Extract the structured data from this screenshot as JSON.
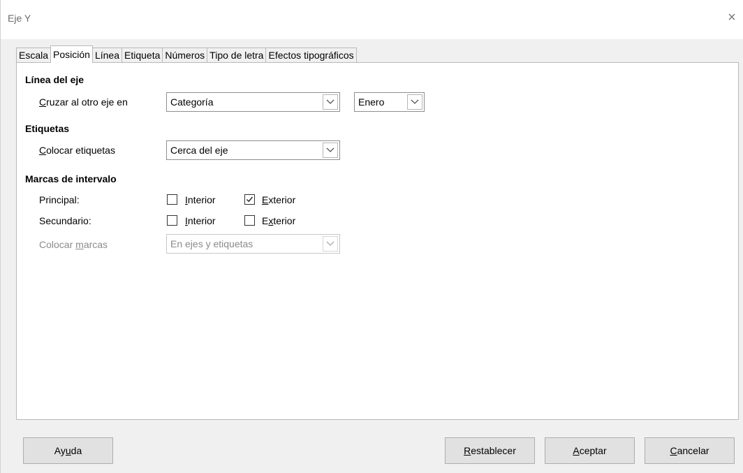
{
  "window": {
    "title": "Eje Y",
    "close_glyph": "×"
  },
  "tabs": [
    {
      "label": "Escala"
    },
    {
      "label": "Posición",
      "active": true
    },
    {
      "label": "Línea"
    },
    {
      "label": "Etiqueta"
    },
    {
      "label": "Números"
    },
    {
      "label": "Tipo de letra"
    },
    {
      "label": "Efectos tipográficos"
    }
  ],
  "axis_line": {
    "heading": "Línea del eje",
    "cross_label_u": "C",
    "cross_label_rest": "ruzar al otro eje en",
    "cross_value": "Categoría",
    "category_value": "Enero"
  },
  "labels_section": {
    "heading": "Etiquetas",
    "place_label_u": "C",
    "place_label_rest": "olocar etiquetas",
    "place_value": "Cerca del eje"
  },
  "interval_marks": {
    "heading": "Marcas de intervalo",
    "major": {
      "label": "Principal:",
      "inner_u": "I",
      "inner_rest": "nterior",
      "inner_checked": false,
      "outer_u": "E",
      "outer_rest": "xterior",
      "outer_checked": true
    },
    "minor": {
      "label": "Secundario:",
      "inner_u": "I",
      "inner_rest": "nterior",
      "inner_checked": false,
      "outer_pre": "E",
      "outer_u": "x",
      "outer_rest": "terior",
      "outer_checked": false
    },
    "place_marks_pre": "Colocar ",
    "place_marks_u": "m",
    "place_marks_rest": "arcas",
    "place_marks_value": "En ejes y etiquetas"
  },
  "footer": {
    "help_pre": "Ay",
    "help_u": "u",
    "help_rest": "da",
    "reset_u": "R",
    "reset_rest": "establecer",
    "ok_u": "A",
    "ok_rest": "ceptar",
    "cancel_u": "C",
    "cancel_rest": "ancelar"
  },
  "icons": {
    "close": "close-icon",
    "dropdown": "chevron-down-icon",
    "check": "checkmark-icon"
  }
}
